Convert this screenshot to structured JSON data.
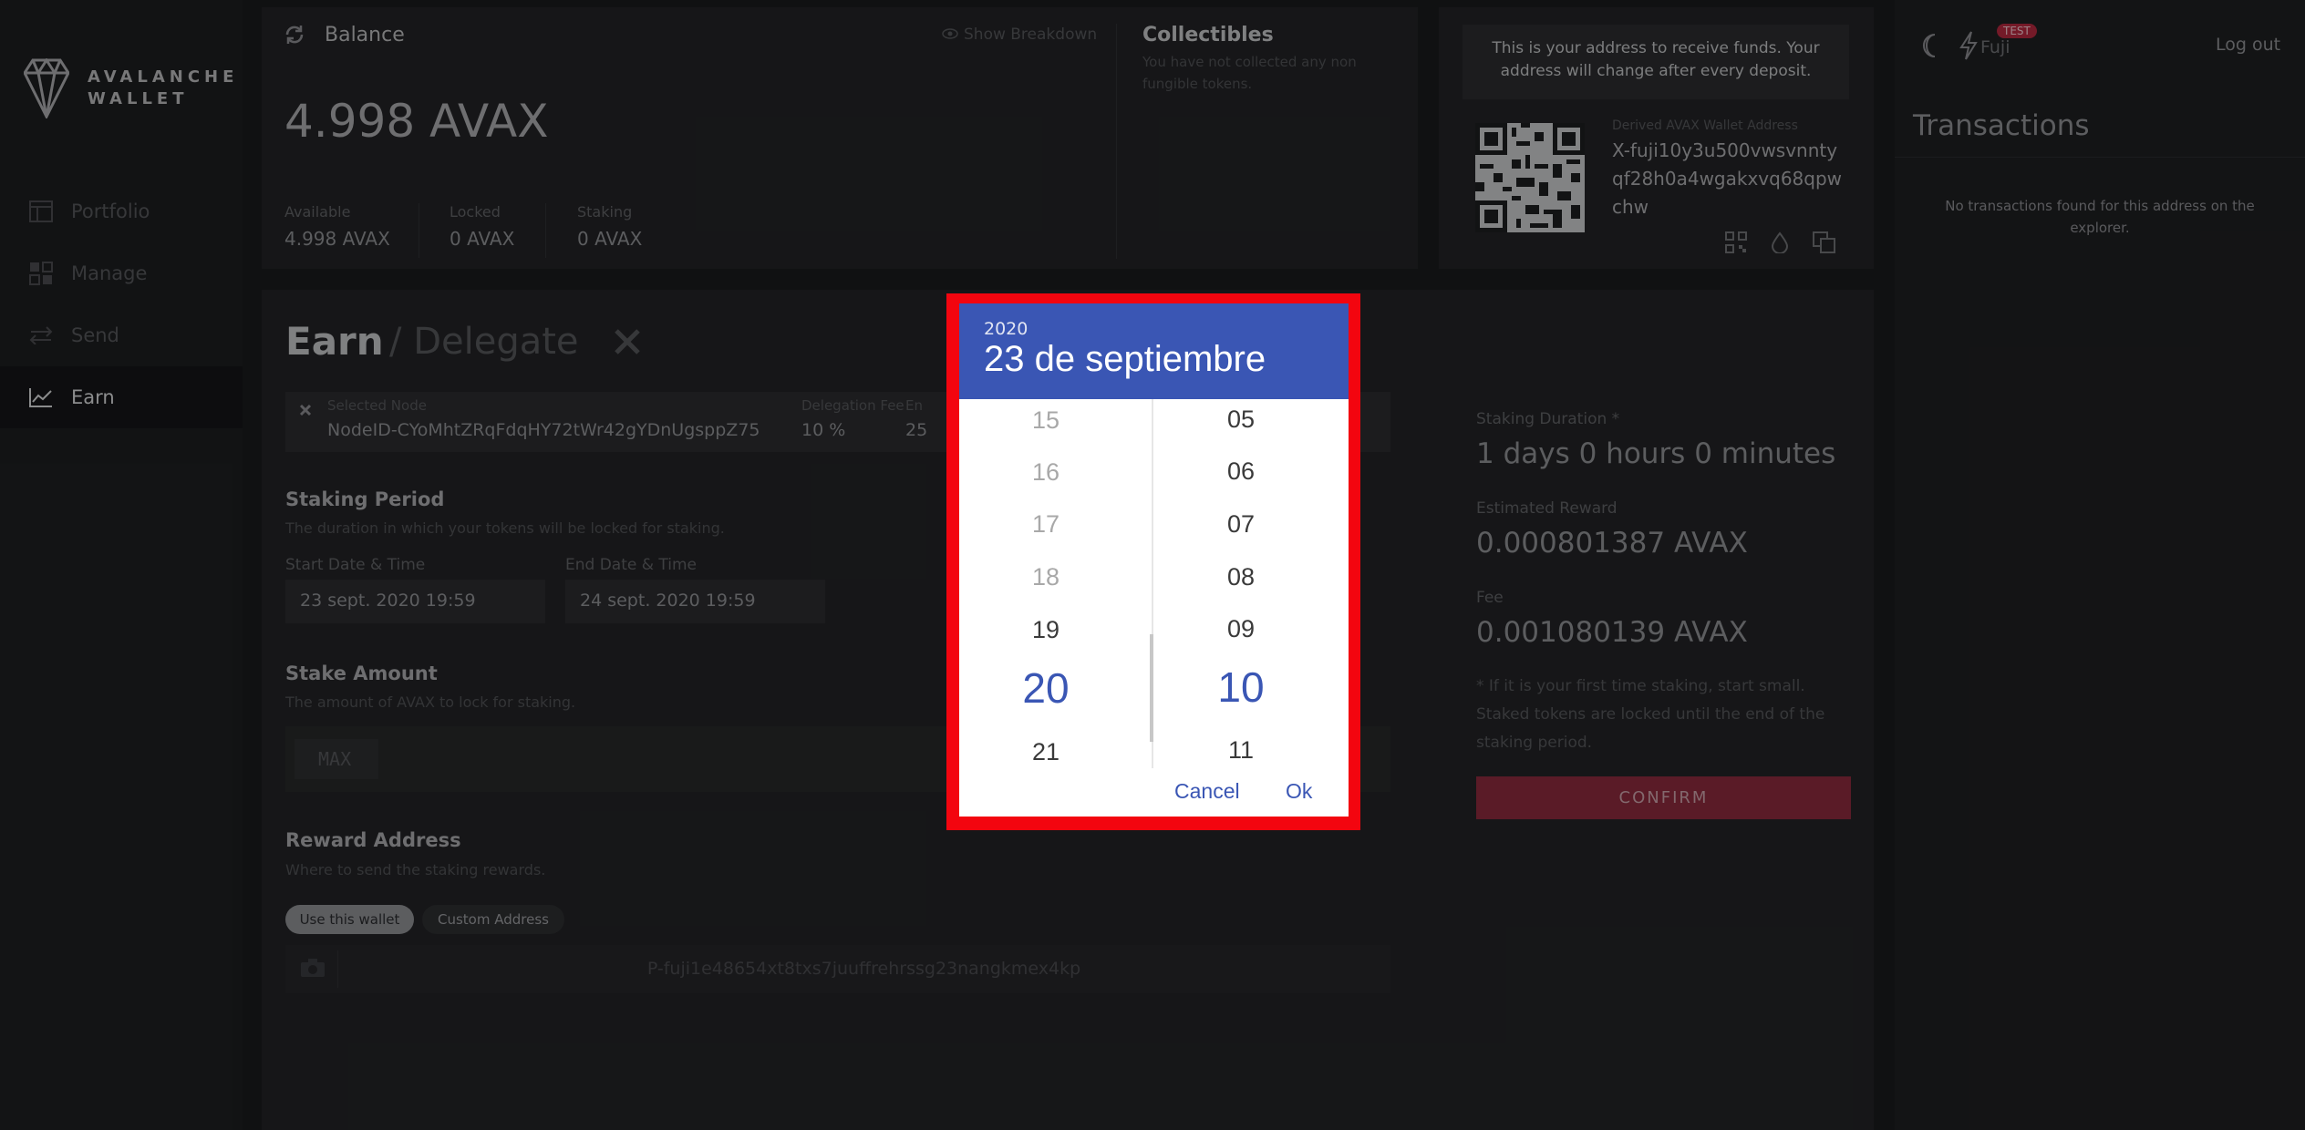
{
  "sidebar": {
    "logo_line1": "AVALANCHE",
    "logo_line2": "WALLET",
    "items": [
      {
        "label": "Portfolio",
        "icon": "portfolio-icon"
      },
      {
        "label": "Manage",
        "icon": "manage-icon"
      },
      {
        "label": "Send",
        "icon": "send-icon"
      },
      {
        "label": "Earn",
        "icon": "earn-icon"
      }
    ]
  },
  "balance": {
    "title": "Balance",
    "show_breakdown": "Show Breakdown",
    "amount": "4.998 AVAX",
    "available_label": "Available",
    "available_value": "4.998 AVAX",
    "locked_label": "Locked",
    "locked_value": "0 AVAX",
    "staking_label": "Staking",
    "staking_value": "0 AVAX"
  },
  "collectibles": {
    "title": "Collectibles",
    "empty_text": "You have not collected any non fungible tokens."
  },
  "address": {
    "notice": "This is your address to receive funds. Your address will change after every deposit.",
    "derived_label": "Derived AVAX Wallet Address",
    "line1": "X-fuji10y3u500vwsvnnty",
    "line2": "qf28h0a4wgakxvq68qpw",
    "line3": "chw"
  },
  "header": {
    "network": "Fuji",
    "badge": "TEST",
    "logout": "Log out"
  },
  "transactions": {
    "title": "Transactions",
    "empty": "No transactions found for this address on the explorer."
  },
  "earn": {
    "title": "Earn",
    "subtitle": "/ Delegate",
    "selected_node_label": "Selected Node",
    "selected_node_value": "NodeID-CYoMhtZRqFdqHY72tWr42gYDnUgsppZ75",
    "delegation_fee_label": "Delegation Fee",
    "delegation_fee_value": "10 %",
    "end_label_partial": "En",
    "end_value_partial": "25",
    "staking_period_title": "Staking Period",
    "staking_period_desc": "The duration in which your tokens will be locked for staking.",
    "start_label": "Start Date & Time",
    "start_value": "23 sept. 2020 19:59",
    "end_label": "End Date & Time",
    "end_value": "24 sept. 2020 19:59",
    "stake_amount_title": "Stake Amount",
    "stake_amount_desc": "The amount of AVAX to lock for staking.",
    "max_label": "MAX",
    "reward_title": "Reward Address",
    "reward_desc": "Where to send the staking rewards.",
    "use_wallet": "Use this wallet",
    "custom_address": "Custom Address",
    "reward_address": "P-fuji1e48654xt8txs7juuffrehrssg23nangkmex4kp"
  },
  "summary": {
    "duration_label": "Staking Duration *",
    "duration_value": "1 days 0 hours 0 minutes",
    "reward_label": "Estimated Reward",
    "reward_value": "0.000801387 AVAX",
    "fee_label": "Fee",
    "fee_value": "0.001080139 AVAX",
    "note": "* If it is your first time staking, start small. Staked tokens are locked until the end of the staking period.",
    "confirm": "CONFIRM"
  },
  "picker": {
    "year": "2020",
    "date": "23 de septiembre",
    "hours": [
      "15",
      "16",
      "17",
      "18",
      "19",
      "20",
      "21"
    ],
    "minutes": [
      "05",
      "06",
      "07",
      "08",
      "09",
      "10",
      "11"
    ],
    "selected_hour": "20",
    "selected_minute": "10",
    "cancel": "Cancel",
    "ok": "Ok"
  },
  "colors": {
    "accent_blue": "#3a56b4",
    "highlight_red": "#f3050f",
    "confirm_red": "#8a2a3c"
  }
}
